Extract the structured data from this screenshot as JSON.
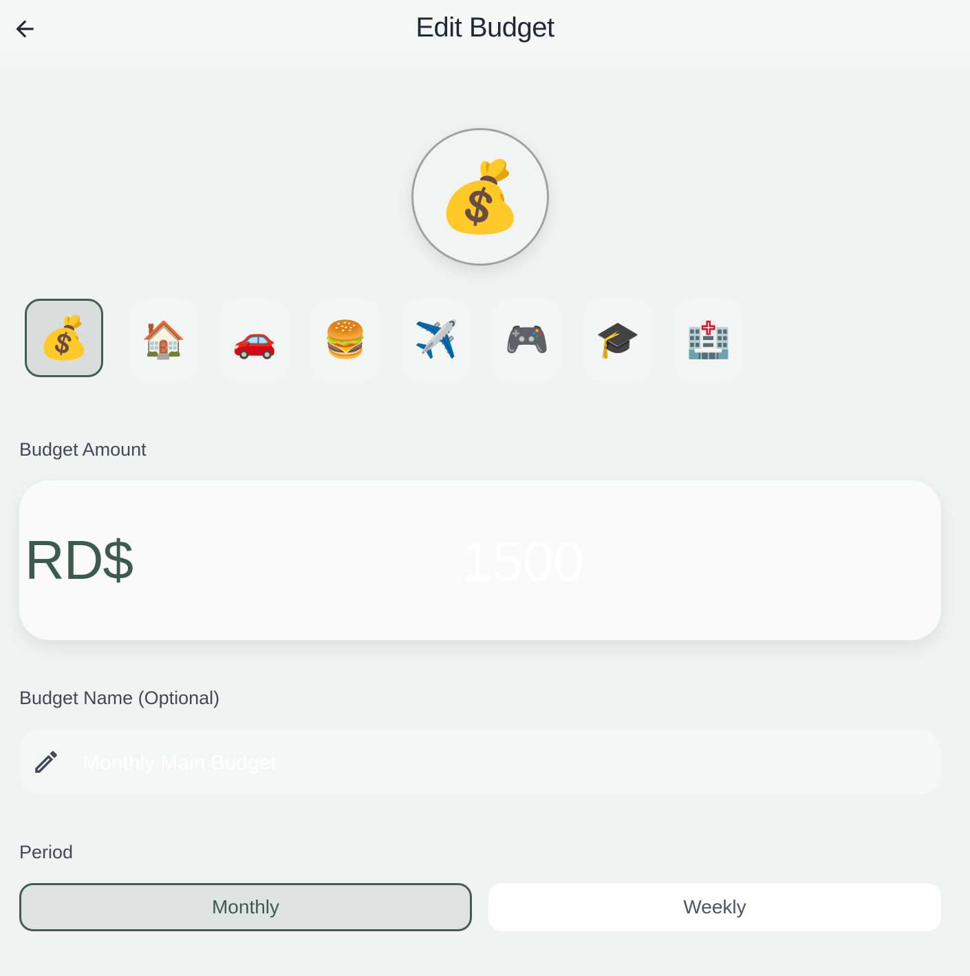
{
  "header": {
    "title": "Edit Budget",
    "back_icon": "arrow-left-icon"
  },
  "selected_icon": {
    "emoji": "💰",
    "name": "money-bag-icon"
  },
  "icon_options": [
    {
      "emoji": "💰",
      "name": "money-bag-icon",
      "selected": true
    },
    {
      "emoji": "🏠",
      "name": "house-icon",
      "selected": false
    },
    {
      "emoji": "🚗",
      "name": "car-icon",
      "selected": false
    },
    {
      "emoji": "🍔",
      "name": "burger-icon",
      "selected": false
    },
    {
      "emoji": "✈️",
      "name": "airplane-icon",
      "selected": false
    },
    {
      "emoji": "🎮",
      "name": "game-controller-icon",
      "selected": false
    },
    {
      "emoji": "🎓",
      "name": "graduation-cap-icon",
      "selected": false
    },
    {
      "emoji": "🏥",
      "name": "hospital-icon",
      "selected": false
    }
  ],
  "amount": {
    "label": "Budget Amount",
    "currency": "RD$",
    "placeholder": "1500"
  },
  "name": {
    "label": "Budget Name (Optional)",
    "placeholder": "Monthly Main Budget",
    "icon": "pencil-icon"
  },
  "period": {
    "label": "Period",
    "options": [
      {
        "label": "Monthly",
        "selected": true
      },
      {
        "label": "Weekly",
        "selected": false
      }
    ]
  },
  "colors": {
    "accent": "#435c52",
    "background": "#eff3f2",
    "title": "#1f2937"
  }
}
